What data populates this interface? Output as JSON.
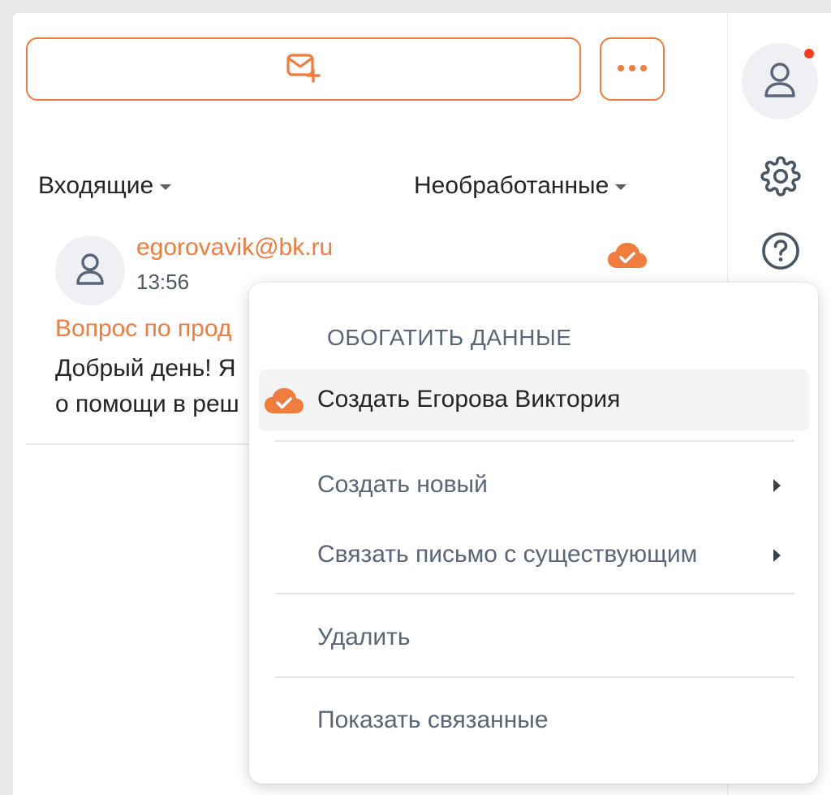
{
  "toolbar": {
    "compose_icon": "envelope-plus-icon",
    "more_icon": "ellipsis-icon"
  },
  "filters": {
    "folder": "Входящие",
    "status": "Необработанные"
  },
  "email": {
    "sender": "egorovavik@bk.ru",
    "time": "13:56",
    "subject": "Вопрос по прод",
    "preview_line1": "Добрый день! Я",
    "preview_line2": "о помощи в реш",
    "status_icon": "cloud-check-icon"
  },
  "sidebar": {
    "profile_icon": "user-icon",
    "settings_icon": "gear-icon",
    "help_icon": "question-circle-icon",
    "has_notification": true
  },
  "context_menu": {
    "header": "ОБОГАТИТЬ ДАННЫЕ",
    "items": [
      {
        "label": "Создать Егорова Виктория"
      },
      {
        "label": "Создать новый"
      },
      {
        "label": "Связать письмо с существующим"
      },
      {
        "label": "Удалить"
      },
      {
        "label": "Показать связанные"
      }
    ]
  },
  "colors": {
    "accent": "#f07c3e",
    "notification": "#ff3b1f",
    "text_primary": "#222629",
    "text_muted": "#5a6678"
  }
}
